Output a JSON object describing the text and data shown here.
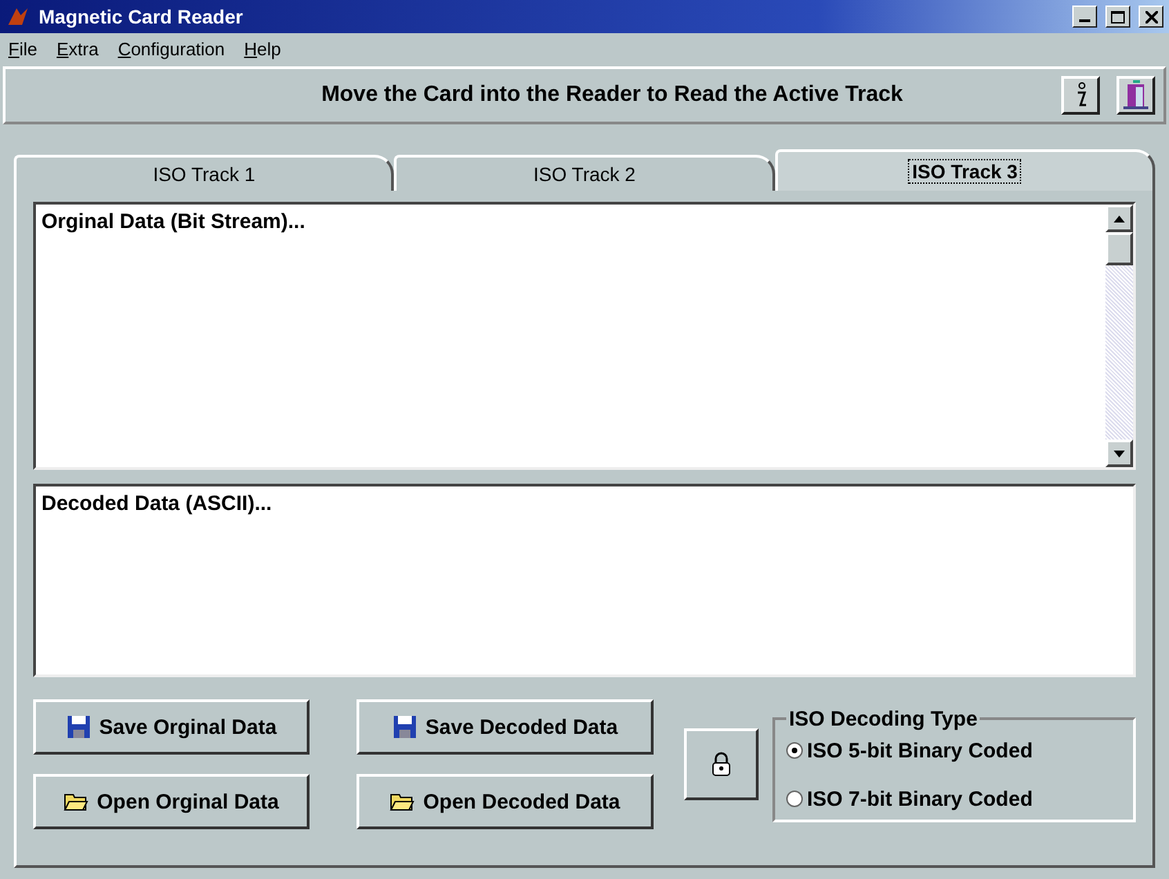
{
  "window": {
    "title": "Magnetic Card Reader"
  },
  "menu": [
    "File",
    "Extra",
    "Configuration",
    "Help"
  ],
  "banner": {
    "message": "Move the Card into the Reader to Read the Active Track"
  },
  "tabs": [
    {
      "label": "ISO Track 1",
      "selected": false
    },
    {
      "label": "ISO Track 2",
      "selected": false
    },
    {
      "label": "ISO Track 3",
      "selected": true
    }
  ],
  "original_data": {
    "value": "Orginal Data (Bit Stream)..."
  },
  "decoded_data": {
    "value": "Decoded Data (ASCII)..."
  },
  "buttons": [
    {
      "kind": "save",
      "label": "Save Orginal Data"
    },
    {
      "kind": "save",
      "label": "Save Decoded Data"
    },
    {
      "kind": "open",
      "label": "Open Orginal Data"
    },
    {
      "kind": "open",
      "label": "Open Decoded Data"
    }
  ],
  "decoding": {
    "title": "ISO Decoding Type",
    "options": [
      {
        "label": "ISO 5-bit Binary Coded",
        "selected": true
      },
      {
        "label": "ISO 7-bit Binary Coded",
        "selected": false
      }
    ]
  }
}
